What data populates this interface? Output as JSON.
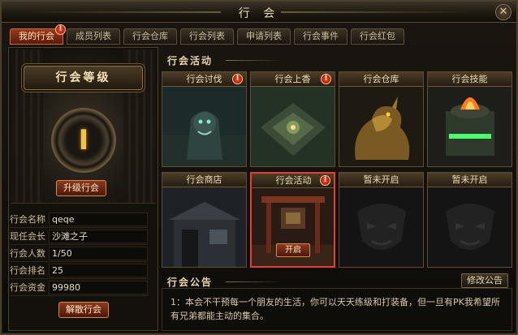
{
  "window": {
    "title": "行 会",
    "close_label": "✕"
  },
  "tabs": [
    {
      "label": "我的行会",
      "badge": "!"
    },
    {
      "label": "成员列表"
    },
    {
      "label": "行会仓库"
    },
    {
      "label": "行会列表"
    },
    {
      "label": "申请列表"
    },
    {
      "label": "行会事件"
    },
    {
      "label": "行会红包"
    }
  ],
  "level": {
    "banner": "行会等级",
    "value": "I",
    "upgrade_label": "升级行会"
  },
  "info": {
    "rows": [
      {
        "label": "行会名称",
        "value": "qeqe"
      },
      {
        "label": "现任会长",
        "value": "沙滩之子"
      },
      {
        "label": "行会人数",
        "value": "1/50"
      },
      {
        "label": "行会排名",
        "value": "25"
      },
      {
        "label": "行会资金",
        "value": "99980"
      }
    ],
    "disband_label": "解散行会"
  },
  "activities": {
    "title": "行会活动",
    "cards": [
      {
        "title": "行会讨伐",
        "badge": "!"
      },
      {
        "title": "行会上香",
        "badge": "!"
      },
      {
        "title": "行会仓库"
      },
      {
        "title": "行会技能"
      },
      {
        "title": "行会商店"
      },
      {
        "title": "行会活动",
        "badge": "!",
        "button": "开启"
      },
      {
        "title": "暂未开启"
      },
      {
        "title": "暂未开启"
      }
    ]
  },
  "notice": {
    "title": "行会公告",
    "edit_label": "修改公告",
    "text": "1：本会不干预每一个朋友的生活，你可以天天练级和打装备，但一旦有PK我希望所有兄弟都能主动的集合。"
  },
  "colors": {
    "accent": "#9c3a1c",
    "highlight": "#e0403a",
    "gold": "#f3c24a"
  }
}
